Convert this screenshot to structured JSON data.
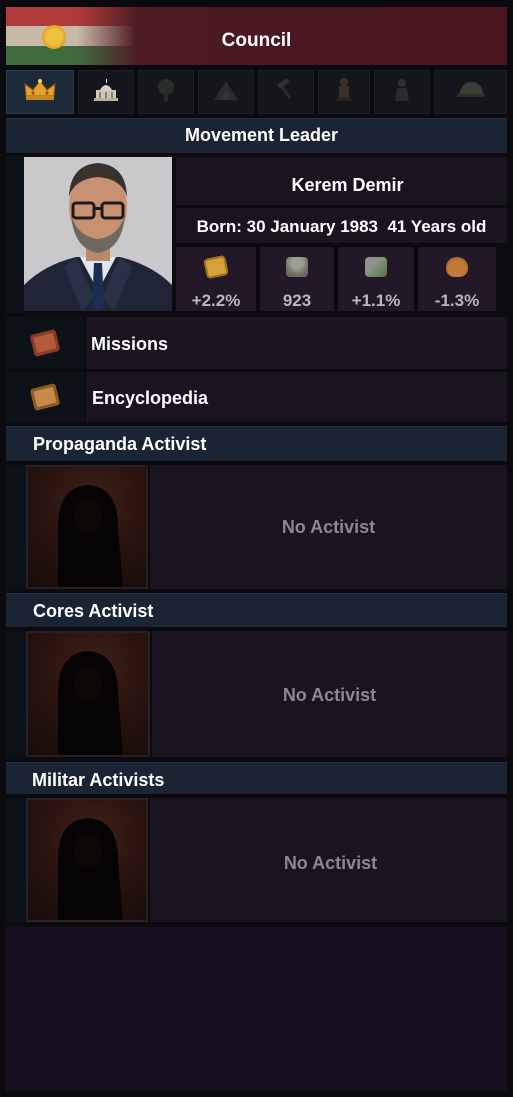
{
  "header": {
    "title": "Council",
    "flag_icon": "kurdistan-flag-icon"
  },
  "tabs": [
    {
      "icon": "crown-icon",
      "active": true
    },
    {
      "icon": "parliament-icon",
      "active": false
    },
    {
      "icon": "tree-icon",
      "active": false
    },
    {
      "icon": "mountain-icon",
      "active": false
    },
    {
      "icon": "hammer-icon",
      "active": false
    },
    {
      "icon": "statue-icon",
      "active": false
    },
    {
      "icon": "soldier-icon",
      "active": false
    },
    {
      "icon": "helmet-icon",
      "active": false
    }
  ],
  "leader": {
    "section_title": "Movement Leader",
    "name": "Kerem Demir",
    "born": "Born: 30 January 1983  41 Years old",
    "stats": [
      {
        "icon": "money-icon",
        "value": "+2.2%"
      },
      {
        "icon": "troops-icon",
        "value": "923"
      },
      {
        "icon": "industry-icon",
        "value": "+1.1%"
      },
      {
        "icon": "bag-icon",
        "value": "-1.3%"
      }
    ]
  },
  "menu": {
    "missions": "Missions",
    "encyclopedia": "Encyclopedia"
  },
  "activists": [
    {
      "title": "Propaganda Activist",
      "status": "No Activist"
    },
    {
      "title": "Cores Activist",
      "status": "No Activist"
    },
    {
      "title": "Militar Activists",
      "status": "No Activist"
    }
  ],
  "colors": {
    "header_bg": "#4a1620",
    "section_bar": "#1b2432",
    "panel": "#1a1320",
    "muted_text": "#8c8890"
  }
}
